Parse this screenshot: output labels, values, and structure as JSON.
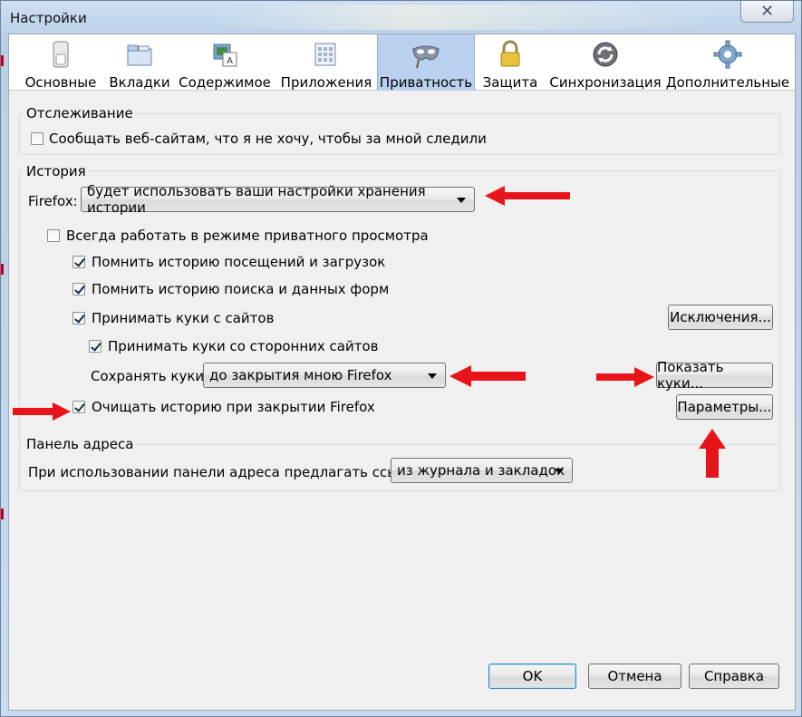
{
  "window": {
    "title": "Настройки",
    "close_glyph": "✕"
  },
  "toolbar": {
    "items": [
      {
        "label": "Основные",
        "icon": "switch-icon"
      },
      {
        "label": "Вкладки",
        "icon": "tabs-icon"
      },
      {
        "label": "Содержимое",
        "icon": "content-icon"
      },
      {
        "label": "Приложения",
        "icon": "applications-icon"
      },
      {
        "label": "Приватность",
        "icon": "mask-icon",
        "active": true
      },
      {
        "label": "Защита",
        "icon": "lock-icon"
      },
      {
        "label": "Синхронизация",
        "icon": "sync-icon"
      },
      {
        "label": "Дополнительные",
        "icon": "gear-icon"
      }
    ]
  },
  "tracking": {
    "title": "Отслеживание",
    "dnt_label": "Сообщать веб-сайтам, что я не хочу, чтобы за мной следили",
    "dnt_checked": false
  },
  "history": {
    "title": "История",
    "firefox_label": "Firefox:",
    "mode_value": "будет использовать ваши настройки хранения истории",
    "private_label": "Всегда работать в режиме приватного просмотра",
    "private_checked": false,
    "remember_browsing_label": "Помнить историю посещений и загрузок",
    "remember_browsing_checked": true,
    "remember_search_label": "Помнить историю поиска и данных форм",
    "remember_search_checked": true,
    "accept_cookies_label": "Принимать куки с сайтов",
    "accept_cookies_checked": true,
    "exceptions_button": "Исключения...",
    "third_party_label": "Принимать куки со сторонних сайтов",
    "third_party_checked": true,
    "keep_cookies_label": "Сохранять куки:",
    "keep_cookies_value": "до закрытия мною Firefox",
    "show_cookies_button": "Показать куки...",
    "clear_on_close_label": "Очищать историю при закрытии Firefox",
    "clear_on_close_checked": true,
    "settings_button": "Параметры..."
  },
  "address_bar": {
    "title": "Панель адреса",
    "suggest_label": "При использовании панели адреса предлагать ссылки:",
    "suggest_value": "из журнала и закладок"
  },
  "footer": {
    "ok": "OK",
    "cancel": "Отмена",
    "help": "Справка"
  },
  "colors": {
    "annotation_arrow": "#e8141b",
    "active_tab": "#b9d1ee"
  }
}
